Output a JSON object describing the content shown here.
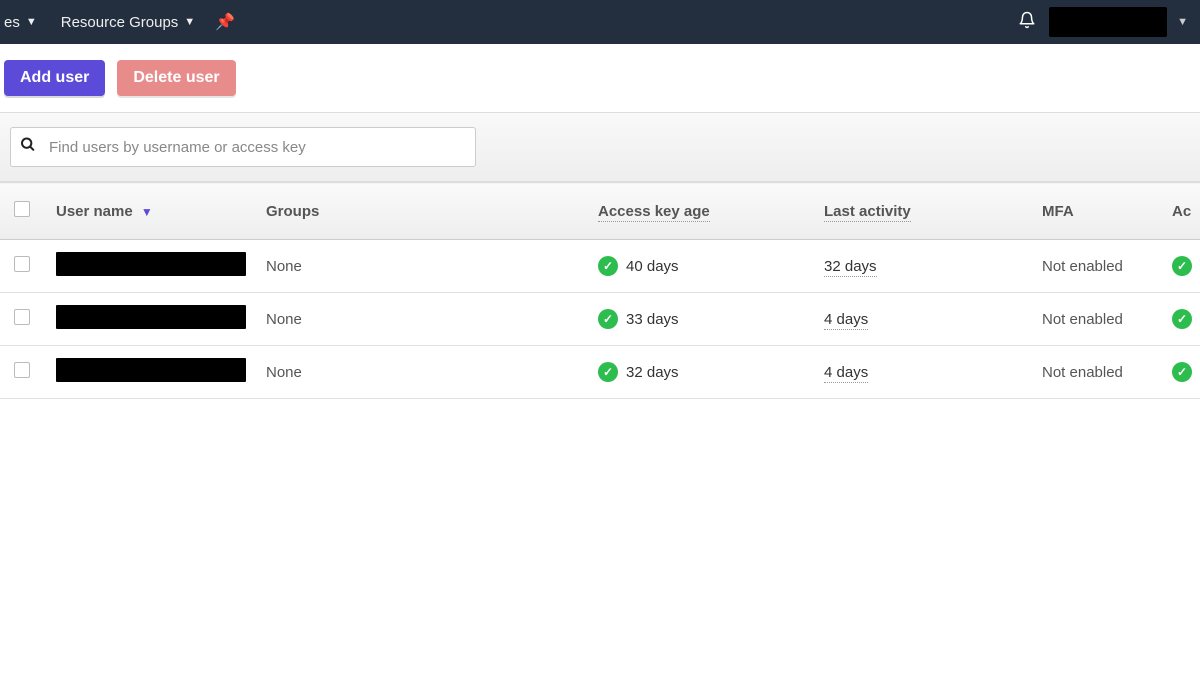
{
  "navbar": {
    "left_truncated": "es",
    "resource_groups_label": "Resource Groups"
  },
  "actions": {
    "add_user": "Add user",
    "delete_user": "Delete user"
  },
  "search": {
    "placeholder": "Find users by username or access key"
  },
  "table": {
    "headers": {
      "user_name": "User name",
      "groups": "Groups",
      "access_key_age": "Access key age",
      "last_activity": "Last activity",
      "mfa": "MFA",
      "trailing": "Ac"
    },
    "rows": [
      {
        "groups": "None",
        "access_key_age": "40 days",
        "last_activity": "32 days",
        "mfa": "Not enabled"
      },
      {
        "groups": "None",
        "access_key_age": "33 days",
        "last_activity": "4 days",
        "mfa": "Not enabled"
      },
      {
        "groups": "None",
        "access_key_age": "32 days",
        "last_activity": "4 days",
        "mfa": "Not enabled"
      }
    ]
  }
}
